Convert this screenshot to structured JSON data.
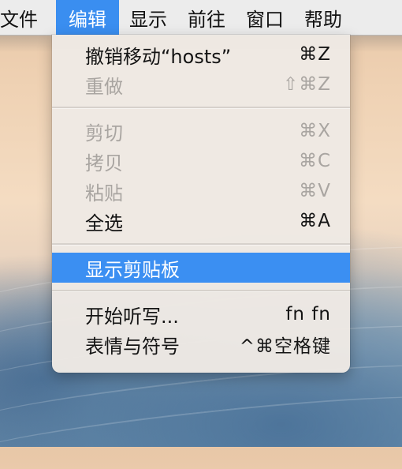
{
  "menubar": {
    "items": [
      {
        "label": "文件"
      },
      {
        "label": "编辑"
      },
      {
        "label": "显示"
      },
      {
        "label": "前往"
      },
      {
        "label": "窗口"
      },
      {
        "label": "帮助"
      }
    ],
    "active_index": 1,
    "accent_color": "#3a8ef0"
  },
  "edit_menu": {
    "groups": [
      [
        {
          "label": "撤销移动“hosts”",
          "shortcut": "⌘Z",
          "enabled": true
        },
        {
          "label": "重做",
          "shortcut": "⇧⌘Z",
          "enabled": false
        }
      ],
      [
        {
          "label": "剪切",
          "shortcut": "⌘X",
          "enabled": false
        },
        {
          "label": "拷贝",
          "shortcut": "⌘C",
          "enabled": false
        },
        {
          "label": "粘贴",
          "shortcut": "⌘V",
          "enabled": false
        },
        {
          "label": "全选",
          "shortcut": "⌘A",
          "enabled": true
        }
      ],
      [
        {
          "label": "显示剪贴板",
          "shortcut": "",
          "enabled": true,
          "highlighted": true
        }
      ],
      [
        {
          "label": "开始听写...",
          "shortcut": "fn fn",
          "enabled": true
        },
        {
          "label": "表情与符号",
          "shortcut": "^⌘空格键",
          "enabled": true
        }
      ]
    ],
    "highlight_color": "#3b8ff2"
  }
}
